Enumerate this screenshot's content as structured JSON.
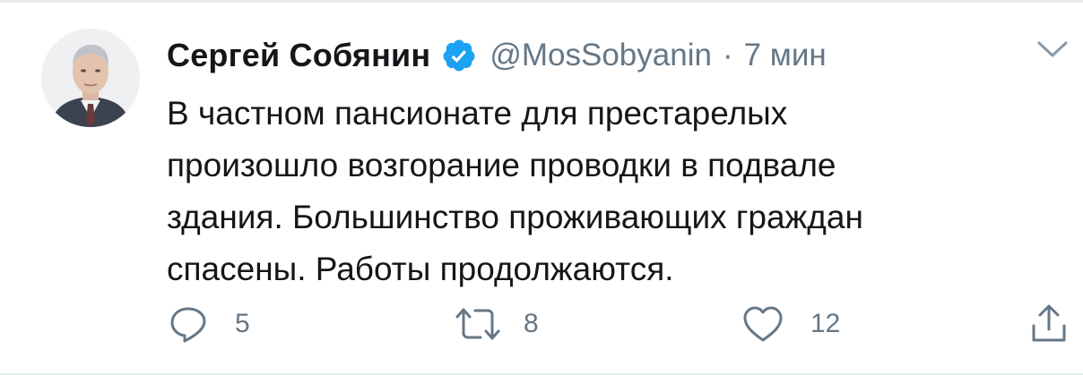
{
  "tweet": {
    "display_name": "Сергей Собянин",
    "handle": "@MosSobyanin",
    "separator": "·",
    "time": "7 мин",
    "verified": true,
    "text_lines": [
      "В частном пансионате для престарелых",
      "произошло возгорание проводки в подвале",
      "здания. Большинство проживающих граждан",
      "спасены. Работы продолжаются."
    ]
  },
  "actions": {
    "replies": "5",
    "retweets": "8",
    "likes": "12"
  },
  "icons": {
    "verified": "verified-badge-icon",
    "caret": "chevron-down-icon",
    "reply": "reply-icon",
    "retweet": "retweet-icon",
    "like": "heart-icon",
    "share": "share-icon"
  },
  "colors": {
    "text_primary": "#14171a",
    "text_secondary": "#657786",
    "verified_blue": "#1da1f2",
    "border": "#e6ecf0"
  }
}
